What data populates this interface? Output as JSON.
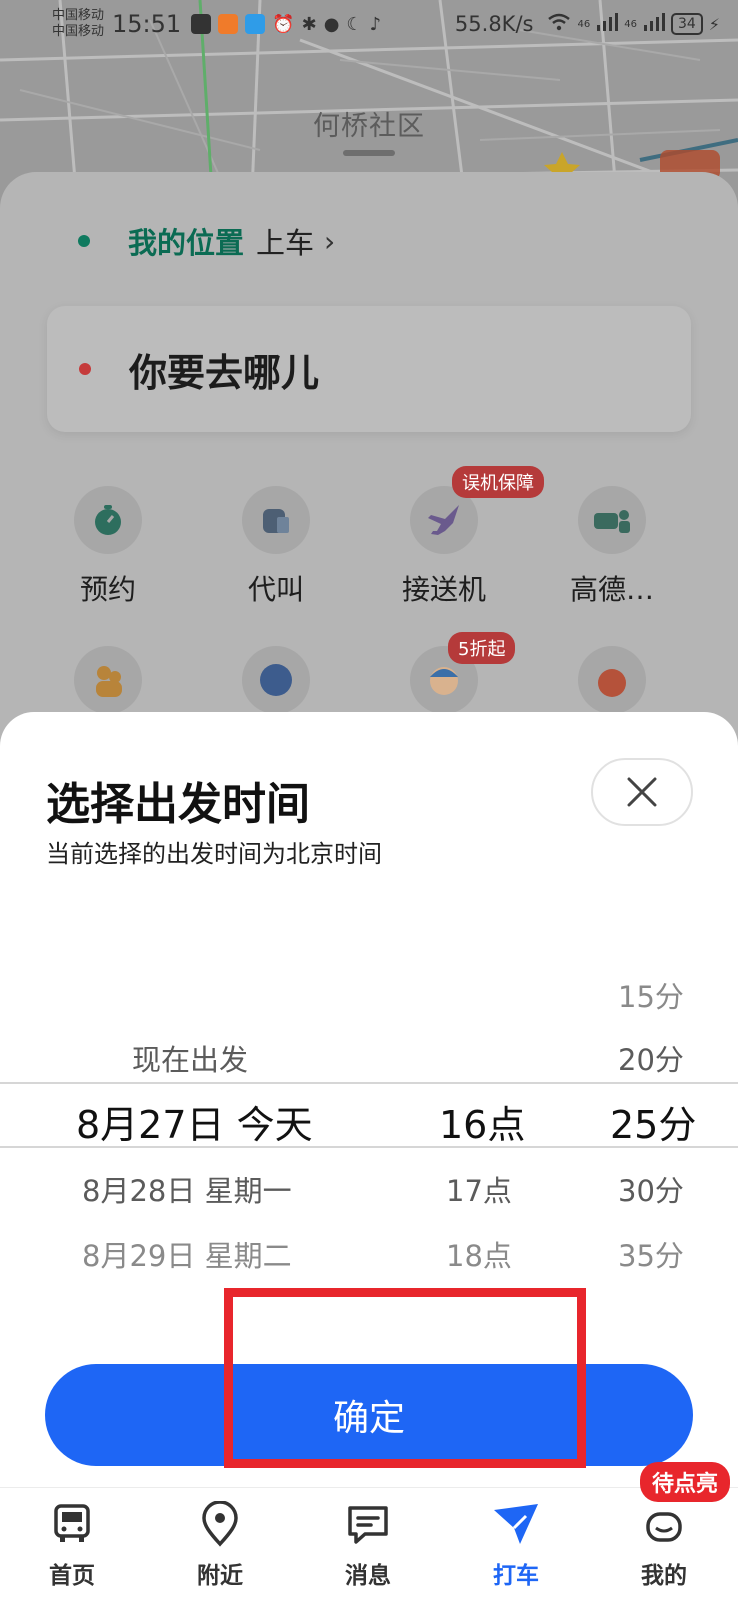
{
  "status_bar": {
    "carrier_1": "中国移动",
    "carrier_2": "中国移动",
    "time": "15:51",
    "net_speed": "55.8K/s",
    "signal_1": "46",
    "signal_2": "46",
    "battery": "34"
  },
  "map": {
    "place_label": "何桥社区"
  },
  "ride_panel": {
    "pickup_location": "我的位置",
    "pickup_action": "上车",
    "destination_placeholder": "你要去哪儿",
    "services": [
      {
        "label": "预约",
        "icon": "clock-icon"
      },
      {
        "label": "代叫",
        "icon": "car-call-icon"
      },
      {
        "label": "接送机",
        "icon": "plane-icon",
        "badge": "误机保障"
      },
      {
        "label": "高德…",
        "icon": "car-passenger-icon"
      }
    ],
    "row2_badge": "5折起"
  },
  "time_modal": {
    "title": "选择出发时间",
    "subtitle": "当前选择的出发时间为北京时间",
    "date_column": [
      "现在出发",
      "8月27日 今天",
      "8月28日 星期一",
      "8月29日 星期二"
    ],
    "hour_column": [
      "16点",
      "17点",
      "18点"
    ],
    "minute_column": [
      "15分",
      "20分",
      "25分",
      "30分",
      "35分"
    ],
    "selected": {
      "date": "8月27日 今天",
      "hour": "16点",
      "minute": "25分"
    },
    "confirm_label": "确定"
  },
  "bottom_nav": {
    "items": [
      {
        "label": "首页",
        "icon": "bus-icon"
      },
      {
        "label": "附近",
        "icon": "location-pin-icon"
      },
      {
        "label": "消息",
        "icon": "message-icon"
      },
      {
        "label": "打车",
        "icon": "taxi-icon",
        "active": true
      },
      {
        "label": "我的",
        "icon": "profile-icon"
      }
    ],
    "badge": "待点亮"
  },
  "colors": {
    "primary_blue": "#1e66f5",
    "highlight_red": "#e8262c",
    "pickup_green": "#0b6b53",
    "dest_red": "#c53b3b"
  }
}
